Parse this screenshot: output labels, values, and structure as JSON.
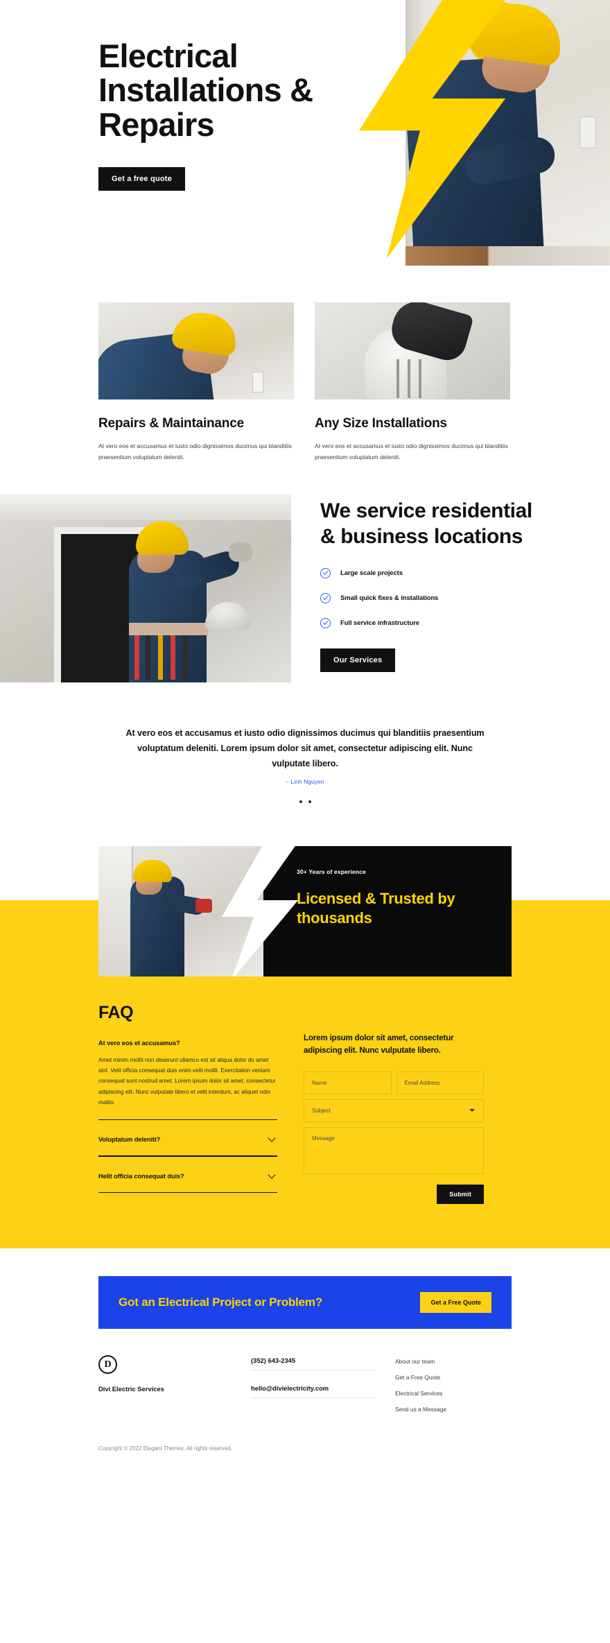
{
  "hero": {
    "title": "Electrical Installations & Repairs",
    "cta_label": "Get a free quote"
  },
  "services": [
    {
      "title": "Repairs & Maintainance",
      "text": "At vero eos et accusamus et iusto odio dignissimos ducimus qui blanditiis praesentium voluptatum deleniti."
    },
    {
      "title": "Any Size Installations",
      "text": "At vero eos et accusamus et iusto odio dignissimos ducimus qui blanditiis praesentium voluptatum deleniti."
    }
  ],
  "weservice": {
    "title": "We service residential & business locations",
    "items": [
      "Large scale projects",
      "Small quick fixes & installations",
      "Full service infrastructure"
    ],
    "cta_label": "Our Services"
  },
  "testimonial": {
    "quote": "At vero eos et accusamus et iusto odio dignissimos ducimus qui blanditiis praesentium voluptatum deleniti. Lorem ipsum dolor sit amet, consectetur adipiscing elit. Nunc vulputate libero.",
    "author": "– Linh Nguyen"
  },
  "licensed": {
    "kicker": "30+ Years of experience",
    "title": "Licensed & Trusted by thousands"
  },
  "faq": {
    "heading": "FAQ",
    "open_item": {
      "question": "At vero eos et accusamus?",
      "answer": "Amet minim mollit non deserunt ullamco est sit aliqua dolor do amet sint. Velit officia consequat duis enim velit mollit. Exercitation veniam consequat sunt nostrud amet. Lorem ipsum dolor sit amet, consectetur adipiscing elit. Nunc vulputate libero et velit interdum, ac aliquet odio mattis."
    },
    "collapsed_items": [
      "Voluptatum deleniti?",
      "Helit officia consequat duis?"
    ]
  },
  "contact": {
    "lead": "Lorem ipsum dolor sit amet, consectetur adipiscing elit. Nunc vulputate libero.",
    "name_placeholder": "Name",
    "email_placeholder": "Email Address",
    "subject_placeholder": "Subject",
    "message_placeholder": "Message",
    "submit_label": "Submit"
  },
  "cta": {
    "title": "Got an Electrical Project or Problem?",
    "button_label": "Get a Free Quote"
  },
  "footer": {
    "logo_letter": "D",
    "brand_name": "Divi Electric Services",
    "phone": "(352) 643-2345",
    "email": "hello@divielectricity.com",
    "links": [
      "About our team",
      "Get a Free Quote",
      "Electrical Services",
      "Send us a Message"
    ],
    "copyright": "Copyright © 2022 Elegant Themes. All rights reserved."
  },
  "colors": {
    "yellow": "#fdd216",
    "bolt_yellow": "#ffd400",
    "blue": "#1a43e8",
    "accent_blue": "#2e5bf0",
    "black": "#111111"
  }
}
